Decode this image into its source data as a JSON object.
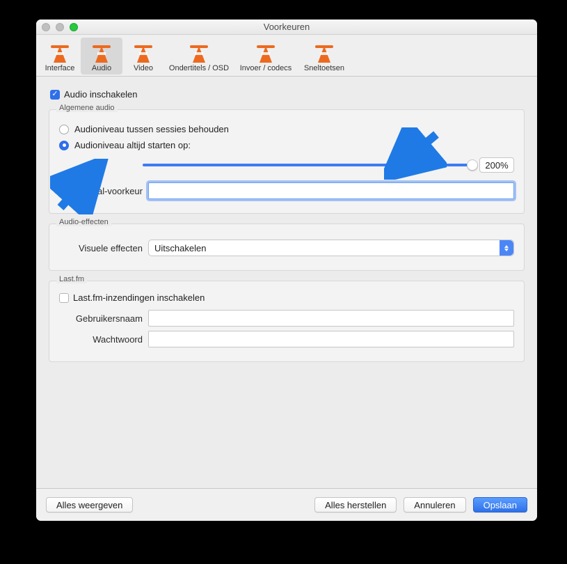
{
  "window": {
    "title": "Voorkeuren"
  },
  "toolbar": {
    "items": [
      {
        "label": "Interface"
      },
      {
        "label": "Audio"
      },
      {
        "label": "Video"
      },
      {
        "label": "Ondertitels / OSD"
      },
      {
        "label": "Invoer / codecs"
      },
      {
        "label": "Sneltoetsen"
      }
    ],
    "selected_index": 1
  },
  "audio": {
    "enable_label": "Audio inschakelen",
    "enable_checked": true,
    "general": {
      "title": "Algemene audio",
      "radio_keep": "Audioniveau tussen sessies behouden",
      "radio_start": "Audioniveau altijd starten op:",
      "selected_radio": 1,
      "percent": "200%",
      "pref_lang_label": "Audiotaal-voorkeur",
      "pref_lang_value": ""
    },
    "effects": {
      "title": "Audio-effecten",
      "visual_label": "Visuele effecten",
      "visual_value": "Uitschakelen"
    },
    "lastfm": {
      "title": "Last.fm",
      "enable_label": "Last.fm-inzendingen inschakelen",
      "enable_checked": false,
      "username_label": "Gebruikersnaam",
      "username_value": "",
      "password_label": "Wachtwoord",
      "password_value": ""
    }
  },
  "footer": {
    "show_all": "Alles weergeven",
    "reset": "Alles herstellen",
    "cancel": "Annuleren",
    "save": "Opslaan"
  }
}
